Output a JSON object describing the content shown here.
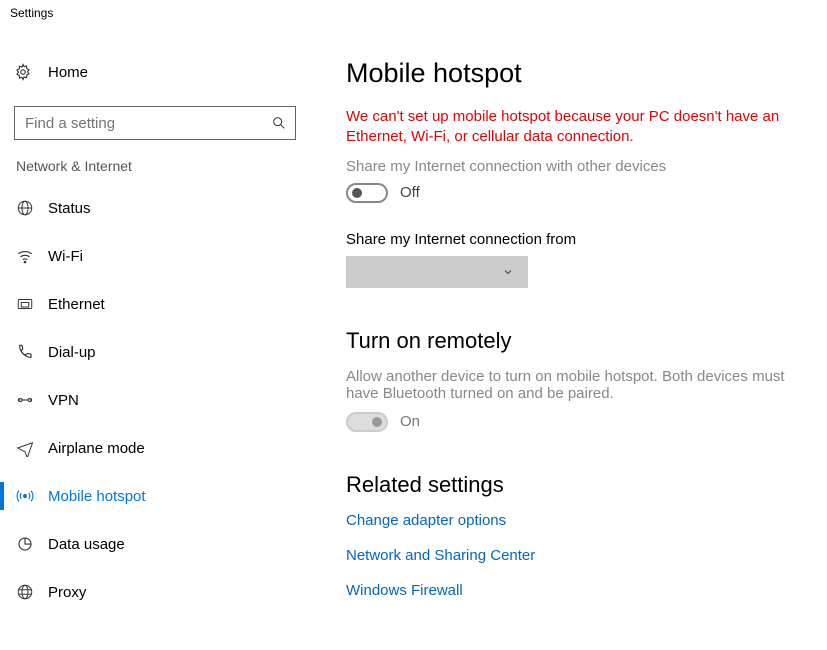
{
  "window": {
    "title": "Settings"
  },
  "sidebar": {
    "home": "Home",
    "search_placeholder": "Find a setting",
    "section": "Network & Internet",
    "items": [
      {
        "label": "Status"
      },
      {
        "label": "Wi-Fi"
      },
      {
        "label": "Ethernet"
      },
      {
        "label": "Dial-up"
      },
      {
        "label": "VPN"
      },
      {
        "label": "Airplane mode"
      },
      {
        "label": "Mobile hotspot"
      },
      {
        "label": "Data usage"
      },
      {
        "label": "Proxy"
      }
    ]
  },
  "page": {
    "title": "Mobile hotspot",
    "error": "We can't set up mobile hotspot because your PC doesn't have an Ethernet, Wi-Fi, or cellular data connection.",
    "share_desc": "Share my Internet connection with other devices",
    "share_toggle": "Off",
    "share_from_label": "Share my Internet connection from",
    "remote_title": "Turn on remotely",
    "remote_desc": "Allow another device to turn on mobile hotspot. Both devices must have Bluetooth turned on and be paired.",
    "remote_toggle": "On",
    "related_title": "Related settings",
    "links": {
      "adapter": "Change adapter options",
      "sharing": "Network and Sharing Center",
      "firewall": "Windows Firewall"
    }
  }
}
